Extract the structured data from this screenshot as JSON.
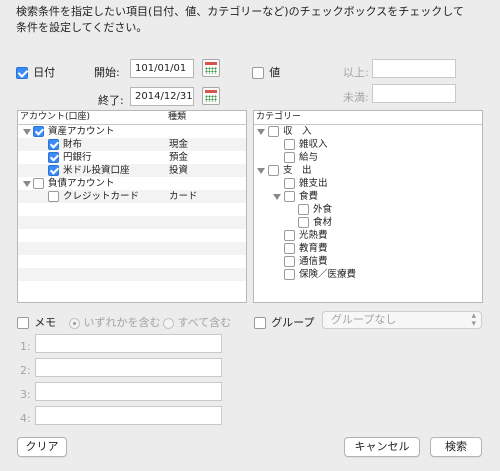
{
  "instruction": {
    "line1": "検索条件を指定したい項目(日付、値、カテゴリーなど)のチェックボックスをチェックして",
    "line2": "条件を設定してください。"
  },
  "date": {
    "label": "日付",
    "start_label": "開始:",
    "start_value": "101/01/01",
    "end_label": "終了:",
    "end_value": "2014/12/31"
  },
  "value": {
    "label": "値",
    "min_label": "以上:",
    "max_label": "未満:"
  },
  "accounts": {
    "col_account": "アカウント(口座)",
    "col_type": "種類",
    "rows": [
      {
        "label": "資産アカウント",
        "type": "",
        "checked": true,
        "tri": true,
        "level": 0
      },
      {
        "label": "財布",
        "type": "現金",
        "checked": true,
        "tri": false,
        "level": 1
      },
      {
        "label": "円銀行",
        "type": "預金",
        "checked": true,
        "tri": false,
        "level": 1
      },
      {
        "label": "米ドル投資口座",
        "type": "投資",
        "checked": true,
        "tri": false,
        "level": 1
      },
      {
        "label": "負債アカウント",
        "type": "",
        "checked": false,
        "tri": true,
        "level": 0
      },
      {
        "label": "クレジットカード",
        "type": "カード",
        "checked": false,
        "tri": false,
        "level": 1
      }
    ]
  },
  "categories": {
    "col_category": "カテゴリー",
    "rows": [
      {
        "label": "収　入",
        "level": 0,
        "tri": true
      },
      {
        "label": "雑収入",
        "level": 1,
        "tri": false
      },
      {
        "label": "給与",
        "level": 1,
        "tri": false
      },
      {
        "label": "支　出",
        "level": 0,
        "tri": true
      },
      {
        "label": "雑支出",
        "level": 1,
        "tri": false
      },
      {
        "label": "食費",
        "level": 1,
        "tri": true
      },
      {
        "label": "外食",
        "level": 2,
        "tri": false
      },
      {
        "label": "食材",
        "level": 2,
        "tri": false
      },
      {
        "label": "光熱費",
        "level": 1,
        "tri": false
      },
      {
        "label": "教育費",
        "level": 1,
        "tri": false
      },
      {
        "label": "通信費",
        "level": 1,
        "tri": false
      },
      {
        "label": "保険／医療費",
        "level": 1,
        "tri": false
      }
    ]
  },
  "memo": {
    "label": "メモ",
    "radio_any": "いずれかを含む",
    "radio_all": "すべて含む",
    "fields": [
      {
        "num": "1:"
      },
      {
        "num": "2:"
      },
      {
        "num": "3:"
      },
      {
        "num": "4:"
      }
    ]
  },
  "group": {
    "label": "グループ",
    "select_value": "グループなし"
  },
  "buttons": {
    "clear": "クリア",
    "cancel": "キャンセル",
    "search": "検索"
  },
  "colors": {
    "accent": "#3b8cf6",
    "background": "#ececec"
  }
}
